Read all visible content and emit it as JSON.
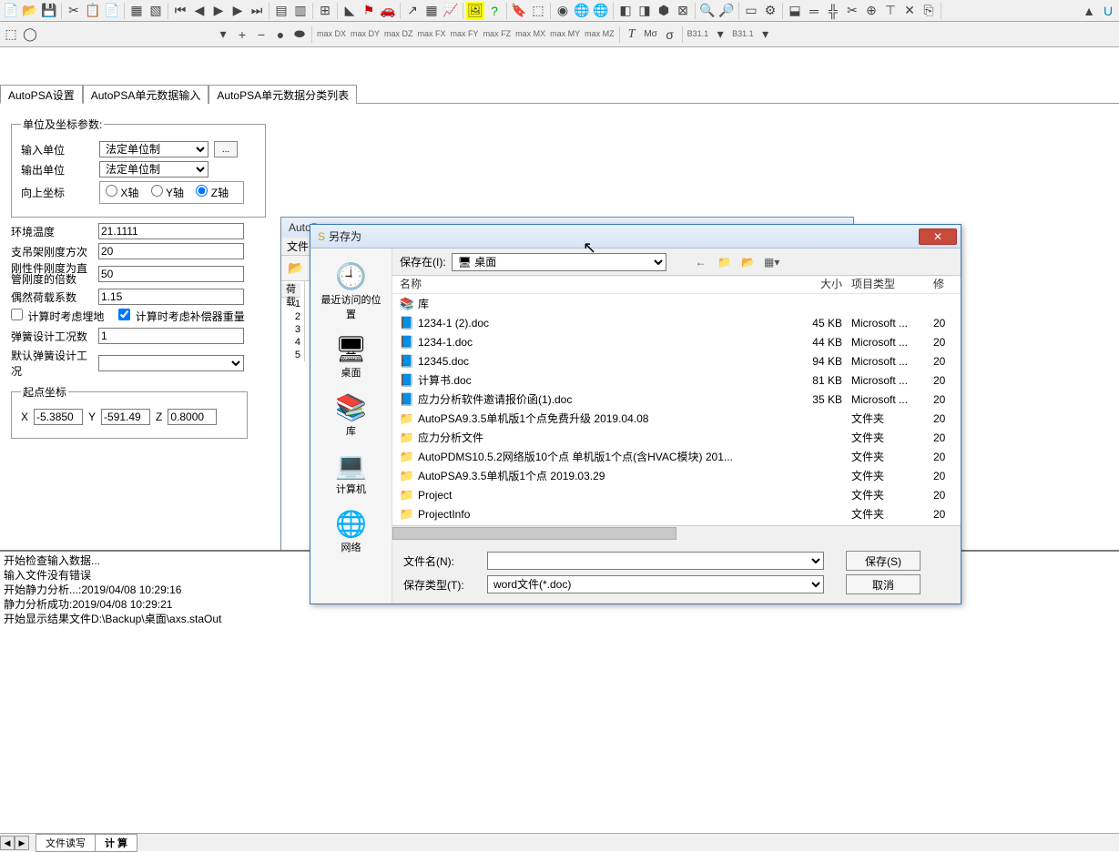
{
  "toolbar": {
    "row1_icons": [
      "file",
      "open",
      "save",
      "sep",
      "cut",
      "copy",
      "paste",
      "sep",
      "doc",
      "doc2",
      "sep",
      "first",
      "prev",
      "play",
      "next",
      "last",
      "sep",
      "grid1",
      "grid2",
      "sep",
      "piv",
      "sep",
      "tri",
      "flag",
      "car",
      "sep",
      "export",
      "table",
      "graph",
      "sep",
      "img",
      "help",
      "sep",
      "tag",
      "3d",
      "sep",
      "sph",
      "globe",
      "globe2",
      "sep",
      "cube",
      "cube2",
      "cyl",
      "net",
      "sep",
      "find",
      "findnext",
      "sep",
      "sel",
      "set",
      "sep",
      "tank",
      "pipe",
      "pipe2",
      "cut2",
      "join",
      "tee",
      "cross",
      "copy2",
      "sep",
      "sep",
      "a",
      "u"
    ],
    "row2_txt": [
      "max DX",
      "max DY",
      "max DZ",
      "max FX",
      "max FY",
      "max FZ",
      "max MX",
      "max MY",
      "max MZ"
    ],
    "b_labels": [
      "B31.1",
      "B31.1"
    ]
  },
  "tabs": [
    {
      "label": "AutoPSA设置",
      "active": true
    },
    {
      "label": "AutoPSA单元数据输入",
      "active": false
    },
    {
      "label": "AutoPSA单元数据分类列表",
      "active": false
    }
  ],
  "form": {
    "fieldset1_legend": "单位及坐标参数:",
    "input_unit_label": "输入单位",
    "input_unit_value": "法定单位制",
    "btn_ellipsis": "...",
    "output_unit_label": "输出单位",
    "output_unit_value": "法定单位制",
    "up_axis_label": "向上坐标",
    "axis_x": "X轴",
    "axis_y": "Y轴",
    "axis_z": "Z轴",
    "env_temp_label": "环境温度",
    "env_temp_value": "21.1111",
    "stiff_exp_label": "支吊架刚度方次",
    "stiff_exp_value": "20",
    "rigid_mult_label": "刚性件刚度为直管刚度的倍数",
    "rigid_mult_value": "50",
    "load_acc_label": "偶然荷载系数",
    "load_acc_value": "1.15",
    "cb_buried": "计算时考虑埋地",
    "cb_comp": "计算时考虑补偿器重量",
    "spring_cases_label": "弹簧设计工况数",
    "spring_cases_value": "1",
    "def_spring_label": "默认弹簧设计工况",
    "origin_legend": "起点坐标",
    "x_lbl": "X",
    "x_val": "-5.3850",
    "y_lbl": "Y",
    "y_val": "-591.49",
    "z_lbl": "Z",
    "z_val": "0.8000"
  },
  "child_win": {
    "title": "AutoP...",
    "menu": "文件",
    "side_hdr": "荷载",
    "rows": [
      "1",
      "2",
      "3",
      "4",
      "5"
    ]
  },
  "dialog": {
    "title": "另存为",
    "save_in_label": "保存在(I):",
    "save_in_value": "桌面",
    "places": [
      {
        "icon": "🕘",
        "label": "最近访问的位置"
      },
      {
        "icon": "🖥",
        "label": "桌面"
      },
      {
        "icon": "📚",
        "label": "库"
      },
      {
        "icon": "💻",
        "label": "计算机"
      },
      {
        "icon": "🌐",
        "label": "网络"
      }
    ],
    "headers": {
      "name": "名称",
      "size": "大小",
      "type": "项目类型",
      "date": "修"
    },
    "files": [
      {
        "icon": "lib",
        "name": "库",
        "size": "",
        "type": "",
        "date": ""
      },
      {
        "icon": "doc",
        "name": "1234-1 (2).doc",
        "size": "45 KB",
        "type": "Microsoft ...",
        "date": "20"
      },
      {
        "icon": "doc",
        "name": "1234-1.doc",
        "size": "44 KB",
        "type": "Microsoft ...",
        "date": "20"
      },
      {
        "icon": "doc",
        "name": "12345.doc",
        "size": "94 KB",
        "type": "Microsoft ...",
        "date": "20"
      },
      {
        "icon": "doc",
        "name": "计算书.doc",
        "size": "81 KB",
        "type": "Microsoft ...",
        "date": "20"
      },
      {
        "icon": "doc",
        "name": "应力分析软件邀请报价函(1).doc",
        "size": "35 KB",
        "type": "Microsoft ...",
        "date": "20"
      },
      {
        "icon": "fold",
        "name": "AutoPSA9.3.5单机版1个点免费升级 2019.04.08",
        "size": "",
        "type": "文件夹",
        "date": "20"
      },
      {
        "icon": "fold",
        "name": "应力分析文件",
        "size": "",
        "type": "文件夹",
        "date": "20"
      },
      {
        "icon": "fold",
        "name": "AutoPDMS10.5.2网络版10个点 单机版1个点(含HVAC模块) 201...",
        "size": "",
        "type": "文件夹",
        "date": "20"
      },
      {
        "icon": "fold",
        "name": "AutoPSA9.3.5单机版1个点 2019.03.29",
        "size": "",
        "type": "文件夹",
        "date": "20"
      },
      {
        "icon": "fold",
        "name": "Project",
        "size": "",
        "type": "文件夹",
        "date": "20"
      },
      {
        "icon": "fold",
        "name": "ProjectInfo",
        "size": "",
        "type": "文件夹",
        "date": "20"
      }
    ],
    "filename_label": "文件名(N):",
    "filename_value": "",
    "filetype_label": "保存类型(T):",
    "filetype_value": "word文件(*.doc)",
    "btn_save": "保存(S)",
    "btn_cancel": "取消"
  },
  "log": [
    "开始检查输入数据...",
    "输入文件没有错误",
    "开始静力分析...:2019/04/08 10:29:16",
    "静力分析成功:2019/04/08 10:29:21",
    "开始显示结果文件D:\\Backup\\桌面\\axs.staOut"
  ],
  "bottom_tabs": [
    {
      "label": "文件读写",
      "active": false
    },
    {
      "label": "计 算",
      "active": true
    }
  ]
}
